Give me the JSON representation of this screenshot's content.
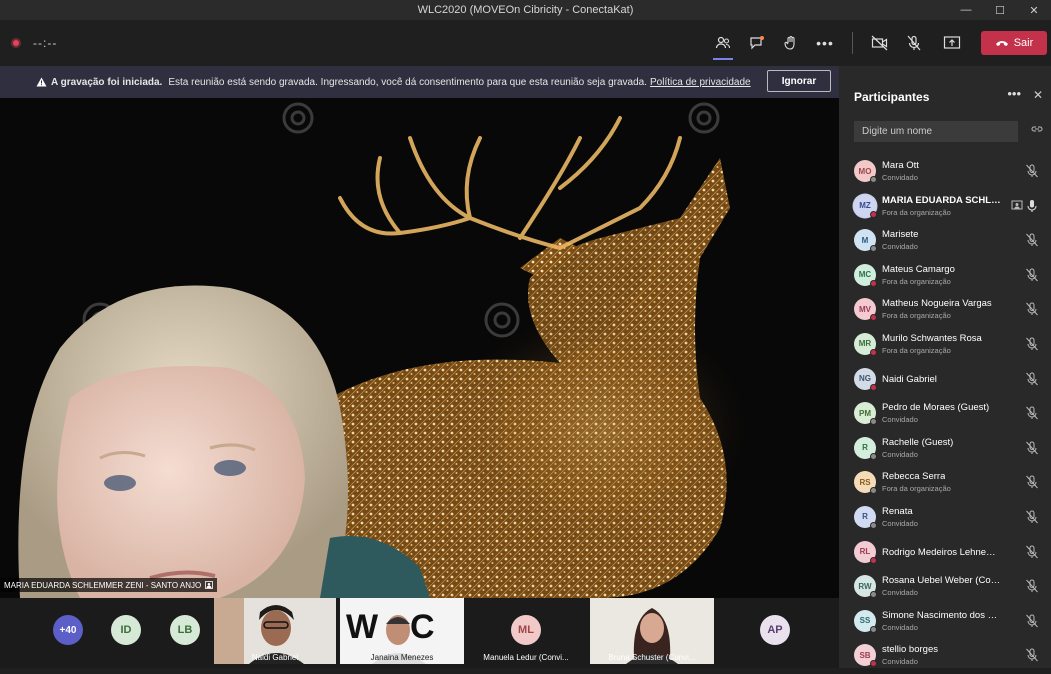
{
  "window": {
    "title": "WLC2020 (MOVEOn Cibricity - ConectaKat)"
  },
  "toolbar": {
    "timer": "--:--",
    "leave_label": "Sair"
  },
  "banner": {
    "title": "A gravação foi iniciada.",
    "message": "Esta reunião está sendo gravada. Ingressando, você dá consentimento para que esta reunião seja gravada.",
    "link": "Política de privacidade",
    "ignore_label": "Ignorar"
  },
  "main_video": {
    "name": "MARIA EDUARDA SCHLEMMER ZENI - SANTO ANJO"
  },
  "strip": {
    "more_count": "+40",
    "avatars": [
      {
        "initials": "ID"
      },
      {
        "initials": "LB"
      }
    ],
    "tiles": [
      {
        "name": "Naidi Gabriel"
      },
      {
        "name": "Janaina Menezes"
      },
      {
        "name": "Manuela Ledur (Convi...",
        "initials": "ML"
      },
      {
        "name": "Bruna Schuster (Convi..."
      }
    ],
    "last_avatar": {
      "initials": "AP"
    }
  },
  "panel": {
    "title": "Participantes",
    "search_placeholder": "Digite um nome",
    "participants": [
      {
        "initials": "MO",
        "name": "Mara Ott",
        "role": "Convidado",
        "bg": "#f1c9c9",
        "fg": "#a0464a",
        "status": "#8a8a8a"
      },
      {
        "initials": "MZ",
        "name": "MARIA EDUARDA SCHLE...",
        "role": "Fora da organização",
        "bg": "#cfd6f1",
        "fg": "#3a4a8a",
        "status": "#c4314b"
      },
      {
        "initials": "M",
        "name": "Marisete",
        "role": "Convidado",
        "bg": "#cfe3f2",
        "fg": "#2d5a80",
        "status": "#8a8a8a"
      },
      {
        "initials": "MC",
        "name": "Mateus Camargo",
        "role": "Fora da organização",
        "bg": "#cfeede",
        "fg": "#2f6f4a",
        "status": "#c4314b"
      },
      {
        "initials": "MV",
        "name": "Matheus Nogueira Vargas",
        "role": "Fora da organização",
        "bg": "#f3c9d2",
        "fg": "#9a3a52",
        "status": "#c4314b"
      },
      {
        "initials": "MR",
        "name": "Murilo Schwantes Rosa",
        "role": "Fora da organização",
        "bg": "#d6ecd6",
        "fg": "#3c6e3c",
        "status": "#c4314b"
      },
      {
        "initials": "NG",
        "name": "Naidi Gabriel",
        "role": "",
        "bg": "#d3dbe6",
        "fg": "#3e5470",
        "status": "#c4314b"
      },
      {
        "initials": "PM",
        "name": "Pedro de Moraes (Guest)",
        "role": "Convidado",
        "bg": "#d9ecd4",
        "fg": "#3f6c36",
        "status": "#8a8a8a"
      },
      {
        "initials": "R",
        "name": "Rachelle (Guest)",
        "role": "Convidado",
        "bg": "#d4eede",
        "fg": "#2f6c48",
        "status": "#8a8a8a"
      },
      {
        "initials": "RS",
        "name": "Rebecca Serra",
        "role": "Fora da organização",
        "bg": "#f5dcb8",
        "fg": "#8a5a1e",
        "status": "#8a8a8a"
      },
      {
        "initials": "R",
        "name": "Renata",
        "role": "Convidado",
        "bg": "#d1dcf2",
        "fg": "#3a4f86",
        "status": "#8a8a8a"
      },
      {
        "initials": "RL",
        "name": "Rodrigo Medeiros Lehnemann",
        "role": "",
        "bg": "#f2cbd3",
        "fg": "#9a3c50",
        "status": "#c4314b"
      },
      {
        "initials": "RW",
        "name": "Rosana Uebel Weber (Convid...",
        "role": "Convidado",
        "bg": "#d6e6e2",
        "fg": "#3b6660",
        "status": "#8a8a8a"
      },
      {
        "initials": "SS",
        "name": "Simone Nascimento dos Santos",
        "role": "Convidado",
        "bg": "#d3eaee",
        "fg": "#2e6670",
        "status": "#8a8a8a"
      },
      {
        "initials": "SB",
        "name": "stellio borges",
        "role": "Convidado",
        "bg": "#f3cfd6",
        "fg": "#9a3c50",
        "status": "#c4314b"
      }
    ]
  }
}
